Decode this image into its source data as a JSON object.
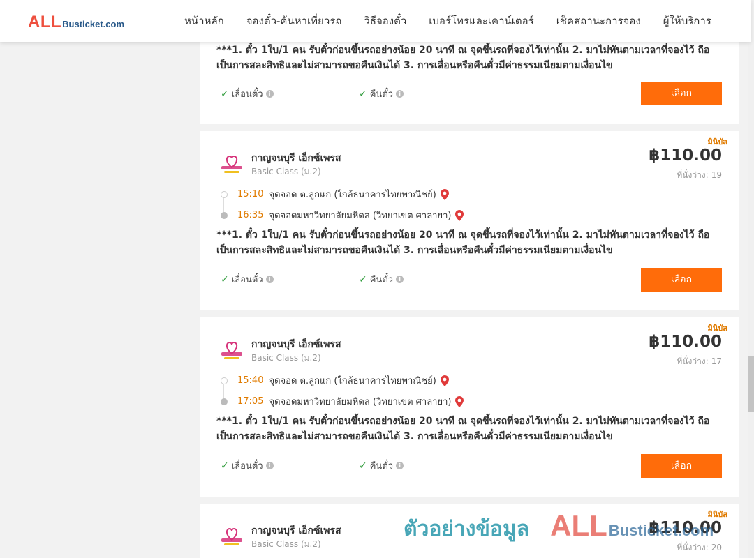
{
  "header": {
    "logo_all": "ALL",
    "logo_rest": "Busticket.com",
    "nav": [
      "หน้าหลัก",
      "จองตั๋ว-ค้นหาเที่ยวรถ",
      "วิธีจองตั๋ว",
      "เบอร์โทรและเคาน์เตอร์",
      "เช็คสถานะการจอง",
      "ผู้ให้บริการ"
    ]
  },
  "note_lines": [
    "***1. ตั๋ว 1ใบ/1 คน รับตั๋วก่อนขึ้นรถอย่างน้อย 20 นาที ณ จุดขึ้นรถที่จองไว้เท่านั้น 2. มาไม่ทันตามเวลาที่จองไว้ ถือ",
    "เป็นการสละสิทธิและไม่สามารถขอคืนเงินได้ 3. การเลื่อนหรือคืนตั๋วมีค่าธรรมเนียมตามเงื่อนไข"
  ],
  "options": {
    "reschedule": "เลื่อนตั๋ว",
    "refund": "คืนตั๋ว",
    "select": "เลือก"
  },
  "trips": [
    {
      "badge": "มินิบัส",
      "operator": "กาญจนบุรี เอ็กซ์เพรส",
      "class": "Basic Class (ม.2)",
      "price": "฿110.00",
      "seats_label": "ที่นั่งว่าง:",
      "seats": "19",
      "depart_time": "15:10",
      "depart_place": "จุดจอด ต.ลูกแก (ใกล้ธนาคารไทยพาณิชย์)",
      "arrive_time": "16:35",
      "arrive_place": "จุดจอดมหาวิทยาลัยมหิดล (วิทยาเขต ศาลายา)"
    },
    {
      "badge": "มินิบัส",
      "operator": "กาญจนบุรี เอ็กซ์เพรส",
      "class": "Basic Class (ม.2)",
      "price": "฿110.00",
      "seats_label": "ที่นั่งว่าง:",
      "seats": "17",
      "depart_time": "15:40",
      "depart_place": "จุดจอด ต.ลูกแก (ใกล้ธนาคารไทยพาณิชย์)",
      "arrive_time": "17:05",
      "arrive_place": "จุดจอดมหาวิทยาลัยมหิดล (วิทยาเขต ศาลายา)"
    },
    {
      "badge": "มินิบัส",
      "operator": "กาญจนบุรี เอ็กซ์เพรส",
      "class": "Basic Class (ม.2)",
      "price": "฿110.00",
      "seats_label": "ที่นั่งว่าง:",
      "seats": "20"
    }
  ],
  "watermark": {
    "text": "ตัวอย่างข้อมูล",
    "all": "ALL",
    "rest": "Busticket.com"
  },
  "colors": {
    "accent": "#ff6c0a",
    "time": "#e07b00",
    "check": "#2e9b3a",
    "logo_red": "#ee4f3e"
  }
}
